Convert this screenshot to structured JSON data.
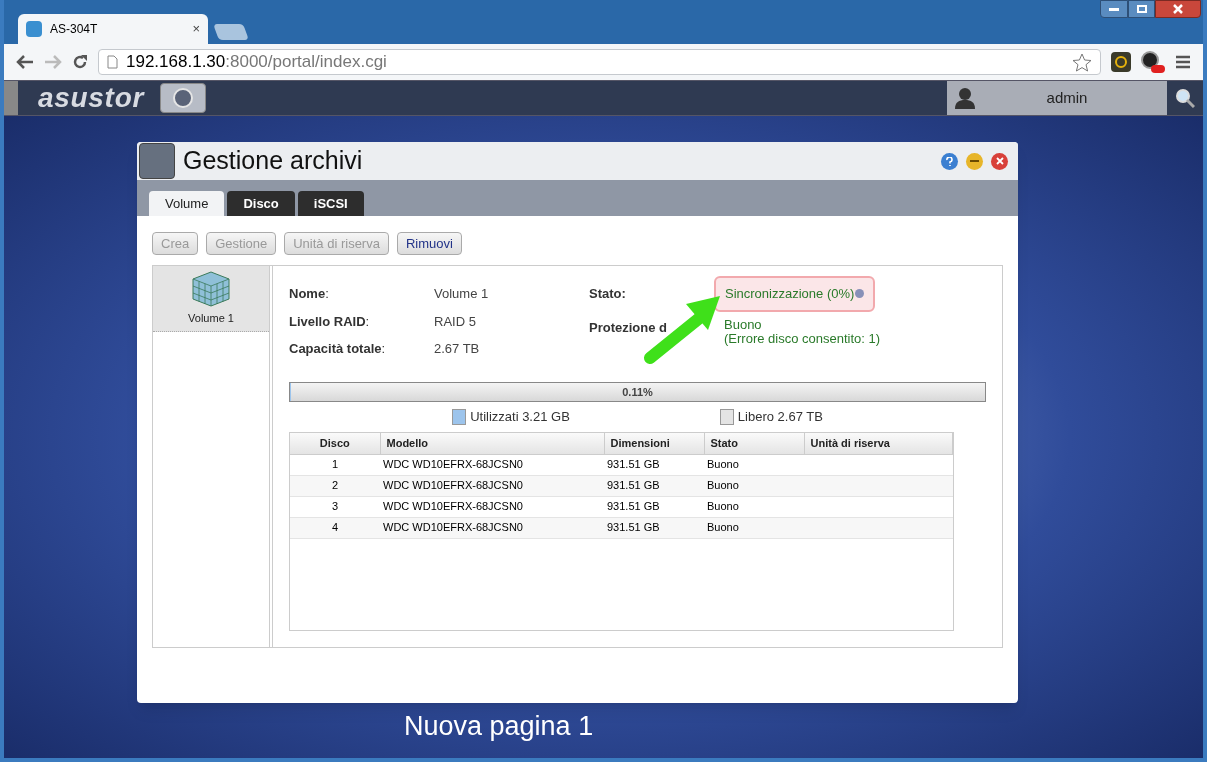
{
  "browser": {
    "tab_title": "AS-304T",
    "tab_close": "×",
    "url_host": "192.168.1.30",
    "url_path": ":8000/portal/index.cgi"
  },
  "topbar": {
    "logo": "asustor",
    "user": "admin"
  },
  "window": {
    "title": "Gestione archivi",
    "tabs": [
      {
        "label": "Volume",
        "selected": true
      },
      {
        "label": "Disco",
        "selected": false
      },
      {
        "label": "iSCSI",
        "selected": false
      }
    ],
    "toolbar": [
      {
        "label": "Crea",
        "disabled": true
      },
      {
        "label": "Gestione",
        "disabled": true
      },
      {
        "label": "Unità di riserva",
        "disabled": true
      },
      {
        "label": "Rimuovi",
        "disabled": false
      }
    ],
    "volumes": [
      {
        "label": "Volume 1",
        "selected": true
      }
    ],
    "details_left": [
      {
        "label": "**Nome**:",
        "value": "Volume 1"
      },
      {
        "label": "**Livello RAID**:",
        "value": "RAID 5"
      },
      {
        "label": "**Capacità totale**:",
        "value": "2.67 TB"
      }
    ],
    "details_right": [
      {
        "kind": "status",
        "label": "Stato:",
        "value": "Sincronizzazione (0%)"
      },
      {
        "kind": "plain",
        "label": "Protezione d",
        "value": "Buono",
        "note": "(Errore disco consentito: 1)"
      }
    ],
    "usage": {
      "level": 0.0011,
      "label": "0.11%"
    },
    "legend": [
      {
        "label": "Utilizzati 3.21 GB",
        "color": "#9cc4ec"
      },
      {
        "label": "Libero 2.67 TB",
        "color": "#e4e4e4"
      }
    ],
    "table": {
      "columns": [
        "Disco",
        "Modello",
        "Dimensioni",
        "Stato",
        "Unità di riserva"
      ],
      "rows": [
        [
          "1",
          "WDC WD10EFRX-68JCSN0",
          "931.51 GB",
          "Buono"
        ],
        [
          "2",
          "WDC WD10EFRX-68JCSN0",
          "931.51 GB",
          "Buono"
        ],
        [
          "3",
          "WDC WD10EFRX-68JCSN0",
          "931.51 GB",
          "Buono"
        ],
        [
          "4",
          "WDC WD10EFRX-68JCSN0",
          "931.51 GB",
          "Buono"
        ]
      ]
    }
  },
  "caption": "Nuova pagina 1"
}
